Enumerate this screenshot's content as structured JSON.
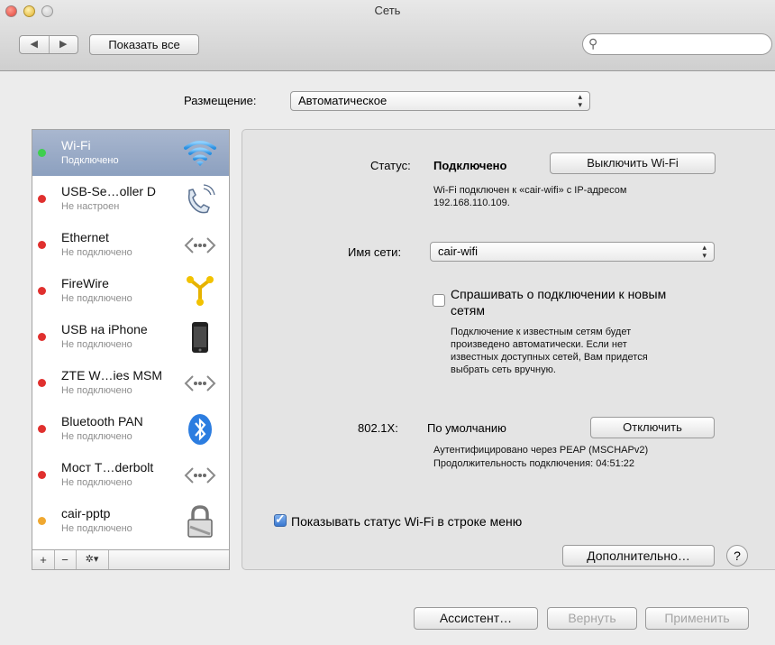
{
  "window": {
    "title": "Сеть"
  },
  "toolbar": {
    "back": "◀",
    "forward": "▶",
    "show_all": "Показать все",
    "search_placeholder": ""
  },
  "location": {
    "label": "Размещение:",
    "value": "Автоматическое"
  },
  "services": [
    {
      "name": "Wi-Fi",
      "status": "Подключено",
      "dot": "#3ecf4e",
      "icon": "wifi-icon",
      "selected": true
    },
    {
      "name": "USB-Se…oller D",
      "status": "Не настроен",
      "dot": "#e0302e",
      "icon": "phone-handset-icon"
    },
    {
      "name": "Ethernet",
      "status": "Не подключено",
      "dot": "#e0302e",
      "icon": "ethernet-icon"
    },
    {
      "name": "FireWire",
      "status": "Не подключено",
      "dot": "#e0302e",
      "icon": "firewire-icon"
    },
    {
      "name": "USB на iPhone",
      "status": "Не подключено",
      "dot": "#e0302e",
      "icon": "iphone-icon"
    },
    {
      "name": "ZTE W…ies MSM",
      "status": "Не подключено",
      "dot": "#e0302e",
      "icon": "ethernet-icon"
    },
    {
      "name": "Bluetooth PAN",
      "status": "Не подключено",
      "dot": "#e0302e",
      "icon": "bluetooth-icon"
    },
    {
      "name": "Мост T…derbolt",
      "status": "Не подключено",
      "dot": "#e0302e",
      "icon": "ethernet-icon"
    },
    {
      "name": "cair-pptp",
      "status": "Не подключено",
      "dot": "#f0a830",
      "icon": "lock-icon"
    }
  ],
  "sidebar_bottom": {
    "add": "+",
    "remove": "−",
    "gear": "✲▾"
  },
  "detail": {
    "status_label": "Статус:",
    "status_value": "Подключено",
    "turn_off_button": "Выключить Wi-Fi",
    "status_desc_line1": "Wi-Fi подключен к «cair-wifi» с IP-адресом",
    "status_desc_line2": "192.168.110.109.",
    "network_label": "Имя сети:",
    "network_value": "cair-wifi",
    "ask_line1": "Спрашивать о подключении к новым",
    "ask_line2": "сетям",
    "ask_checked": false,
    "ask_desc": [
      "Подключение к известным сетям будет",
      "произведено автоматически. Если нет",
      "известных доступных сетей, Вам придется",
      "выбрать сеть вручную."
    ],
    "dot1x_label": "802.1X:",
    "dot1x_value": "По умолчанию",
    "disconnect_button": "Отключить",
    "auth_line1": "Аутентифицировано через PEAP (MSCHAPv2)",
    "auth_line2": "Продолжительность подключения: 04:51:22",
    "show_status_label": "Показывать статус Wi-Fi в строке меню",
    "show_status_checked": true,
    "advanced_button": "Дополнительно…",
    "help": "?"
  },
  "footer": {
    "assistant": "Ассистент…",
    "revert": "Вернуть",
    "apply": "Применить"
  },
  "colors": {
    "selection": "#8ca0bf",
    "connected": "#3ecf4e",
    "error": "#e0302e",
    "inactive": "#f0a830"
  }
}
